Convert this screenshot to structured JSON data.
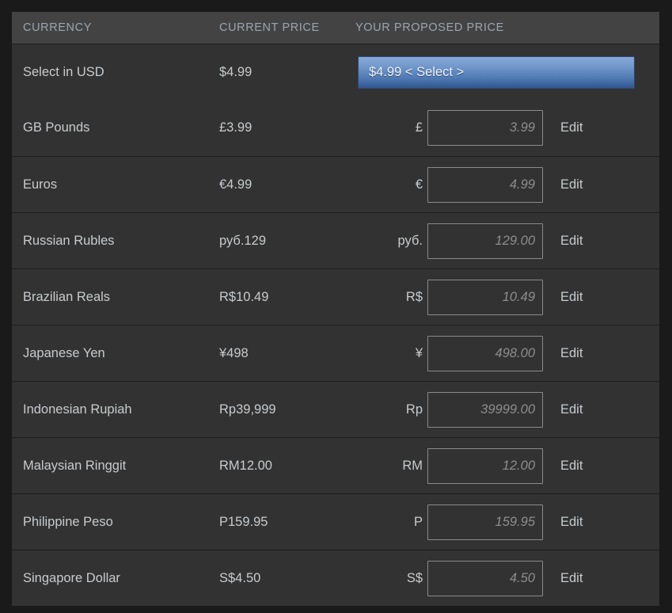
{
  "table": {
    "columns": {
      "currency": "CURRENCY",
      "current_price": "CURRENT PRICE",
      "proposed_price": "YOUR PROPOSED PRICE"
    },
    "select_row": {
      "currency": "Select in USD",
      "current_price": "$4.99",
      "select_button_label": "$4.99 < Select >"
    },
    "edit_label": "Edit",
    "rows": [
      {
        "currency": "GB Pounds",
        "current_price": "£3.99",
        "symbol": "£",
        "placeholder": "3.99",
        "value": ""
      },
      {
        "currency": "Euros",
        "current_price": "€4.99",
        "symbol": "€",
        "placeholder": "4.99",
        "value": ""
      },
      {
        "currency": "Russian Rubles",
        "current_price": "руб.129",
        "symbol": "руб.",
        "placeholder": "129.00",
        "value": ""
      },
      {
        "currency": "Brazilian Reals",
        "current_price": "R$10.49",
        "symbol": "R$",
        "placeholder": "10.49",
        "value": ""
      },
      {
        "currency": "Japanese Yen",
        "current_price": "¥498",
        "symbol": "¥",
        "placeholder": "498.00",
        "value": ""
      },
      {
        "currency": "Indonesian Rupiah",
        "current_price": "Rp39,999",
        "symbol": "Rp",
        "placeholder": "39999.00",
        "value": ""
      },
      {
        "currency": "Malaysian Ringgit",
        "current_price": "RM12.00",
        "symbol": "RM",
        "placeholder": "12.00",
        "value": ""
      },
      {
        "currency": "Philippine Peso",
        "current_price": "P159.95",
        "symbol": "P",
        "placeholder": "159.95",
        "value": ""
      },
      {
        "currency": "Singapore Dollar",
        "current_price": "S$4.50",
        "symbol": "S$",
        "placeholder": "4.50",
        "value": ""
      }
    ]
  },
  "colors": {
    "page_background": "#1a1a1a",
    "header_background": "#434343",
    "row_background": "#323232",
    "row_divider": "#1e1e1e",
    "text": "#c8cbce",
    "header_text": "#9ba5ae",
    "placeholder_text": "#8d8d8d",
    "input_border": "#8a8a8a",
    "select_button_top": "#87a9d6",
    "select_button_bottom": "#32558e",
    "select_button_text": "#eef3fa"
  }
}
